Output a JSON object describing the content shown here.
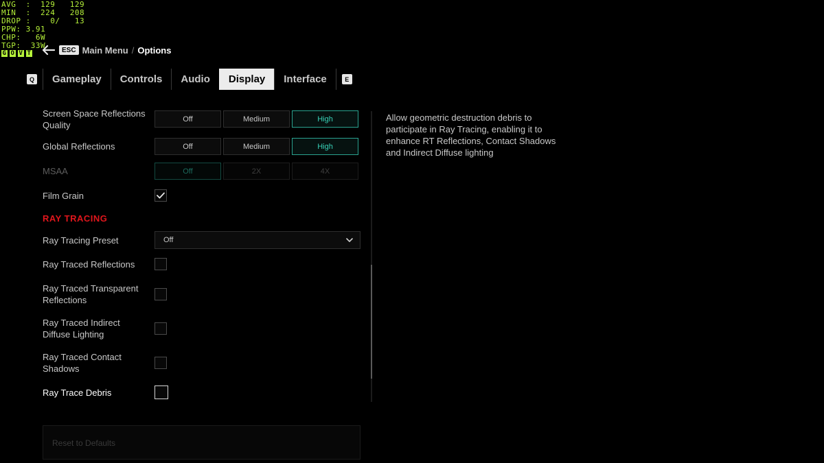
{
  "overlay": {
    "rows": [
      "AVG  :  129   129",
      "MIN  :  224   208",
      "DROP :    0/   13",
      "PPW: 3.91",
      "CHP:   6W",
      "TGP:  33W"
    ],
    "flags": [
      "G",
      "O",
      "V",
      "T"
    ]
  },
  "breadcrumb": {
    "key": "ESC",
    "parent": "Main Menu",
    "separator": "/",
    "current": "Options"
  },
  "tabs": {
    "prev_key": "Q",
    "next_key": "E",
    "items": [
      {
        "label": "Gameplay"
      },
      {
        "label": "Controls"
      },
      {
        "label": "Audio"
      },
      {
        "label": "Display"
      },
      {
        "label": "Interface"
      }
    ],
    "active": "Display"
  },
  "settings": {
    "ssr": {
      "label": "Screen Space Reflections Quality",
      "options": [
        "Off",
        "Medium",
        "High"
      ],
      "selected": "High"
    },
    "global_reflections": {
      "label": "Global Reflections",
      "options": [
        "Off",
        "Medium",
        "High"
      ],
      "selected": "High"
    },
    "msaa": {
      "label": "MSAA",
      "options": [
        "Off",
        "2X",
        "4X"
      ],
      "selected": "Off",
      "disabled": true
    },
    "film_grain": {
      "label": "Film Grain",
      "checked": true
    },
    "ray_tracing_header": "RAY TRACING",
    "rt_preset": {
      "label": "Ray Tracing Preset",
      "value": "Off"
    },
    "rt_reflections": {
      "label": "Ray Traced Reflections",
      "checked": false
    },
    "rt_transparent": {
      "label": "Ray Traced Transparent Reflections",
      "checked": false
    },
    "rt_indirect": {
      "label": "Ray Traced Indirect Diffuse Lighting",
      "checked": false
    },
    "rt_contact": {
      "label": "Ray Traced Contact Shadows",
      "checked": false
    },
    "rt_debris": {
      "label": "Ray Trace Debris",
      "checked": false,
      "focused": true
    }
  },
  "reset": {
    "label": "Reset to Defaults"
  },
  "description": {
    "text": "Allow geometric destruction debris to participate in Ray Tracing, enabling it to enhance RT Reflections, Contact Shadows and Indirect Diffuse lighting"
  },
  "colors": {
    "accent": "#38d2b8",
    "section": "#e0161c",
    "overlay": "#b6f23a"
  }
}
